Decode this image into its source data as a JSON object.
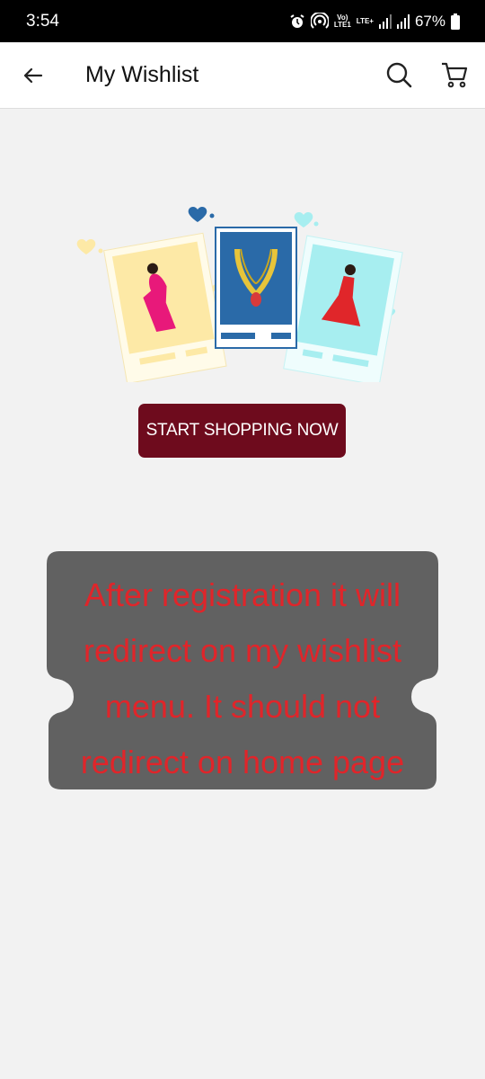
{
  "status_bar": {
    "time": "3:54",
    "network_label": "LTE+",
    "battery_percent": "67%",
    "icons": [
      "alarm-icon",
      "hotspot-icon",
      "volte-icon",
      "signal-icon",
      "battery-icon"
    ]
  },
  "app_bar": {
    "title": "My Wishlist",
    "back_icon": "arrow-left-icon",
    "search_icon": "search-icon",
    "cart_icon": "cart-icon"
  },
  "empty_state": {
    "illustration": "wishlist-cards-illustration",
    "cta_label": "START SHOPPING NOW"
  },
  "annotation": {
    "text": "After registration it will redirect on my wishlist menu. It should not redirect on home page"
  },
  "colors": {
    "cta_bg": "#6e0b1d",
    "note_bg": "#616161",
    "note_text": "#e0252a",
    "card_blue": "#2a6aa8",
    "card_yellow": "#fde9a6",
    "card_cyan": "#a7eef0"
  }
}
